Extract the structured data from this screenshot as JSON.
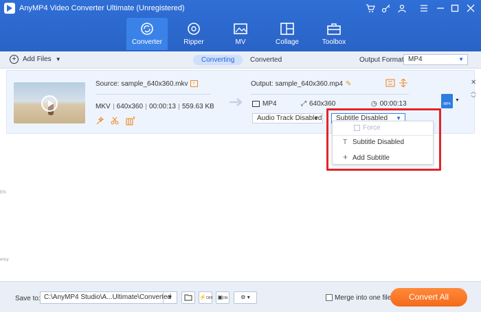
{
  "app": {
    "title": "AnyMP4 Video Converter Ultimate (Unregistered)"
  },
  "window_controls": [
    "cart-icon",
    "key-icon",
    "user-icon",
    "menu-icon",
    "minimize-icon",
    "maximize-icon",
    "close-icon"
  ],
  "main_tabs": [
    {
      "label": "Converter",
      "icon": "converter-icon",
      "active": true
    },
    {
      "label": "Ripper",
      "icon": "ripper-icon"
    },
    {
      "label": "MV",
      "icon": "mv-icon"
    },
    {
      "label": "Collage",
      "icon": "collage-icon"
    },
    {
      "label": "Toolbox",
      "icon": "toolbox-icon"
    }
  ],
  "toolbar": {
    "add_files": "Add Files",
    "converting": "Converting",
    "converted": "Converted",
    "output_format_label": "Output Format:",
    "output_format_value": "MP4"
  },
  "file": {
    "source": "Source: sample_640x360.mkv",
    "format": "MKV",
    "resolution": "640x360",
    "duration": "00:00:13",
    "size": "559.63 KB",
    "output": "Output: sample_640x360.mp4",
    "out_format": "MP4",
    "out_resolution": "640x360",
    "out_duration": "00:00:13",
    "audio_track": "Audio Track Disabled",
    "subtitle": "Subtitle Disabled",
    "format_badge": "MP4"
  },
  "subtitle_menu": {
    "force": "Force",
    "disabled": "Subtitle Disabled",
    "add": "Add Subtitle"
  },
  "side_marks": {
    "a": "EN",
    "b": "ency"
  },
  "bottom": {
    "save_to_label": "Save to:",
    "save_path": "C:\\AnyMP4 Studio\\A...Ultimate\\Converted",
    "merge_label": "Merge into one file",
    "convert_all": "Convert All",
    "hw_off": "OFF",
    "hw_on": "ON"
  },
  "colors": {
    "accent": "#2f6fd6",
    "convert": "#f46a1a",
    "highlight": "#e3232a"
  }
}
